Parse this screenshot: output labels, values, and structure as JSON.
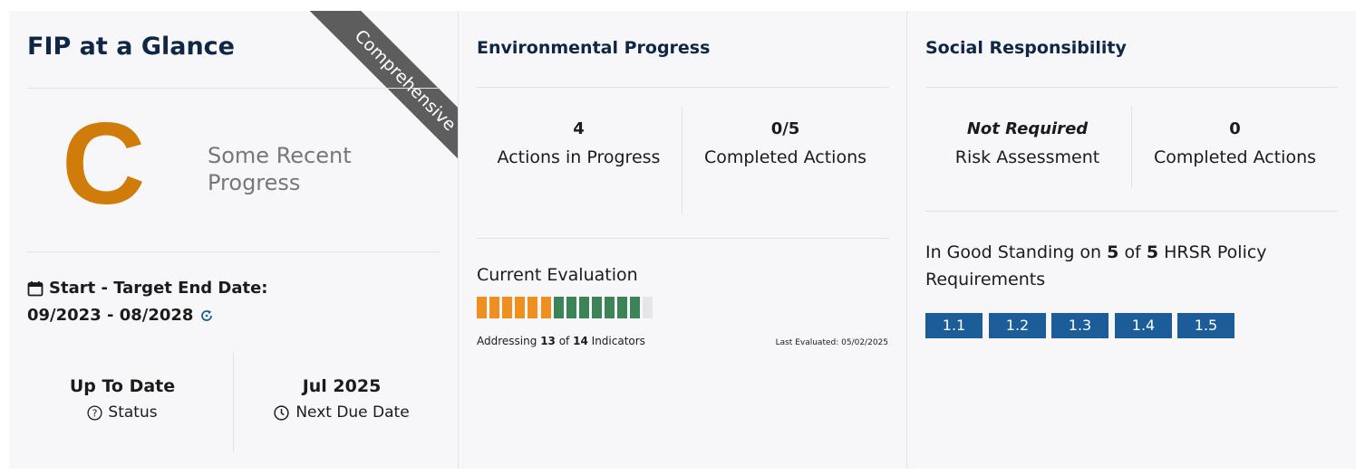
{
  "glance": {
    "title": "FIP at a Glance",
    "ribbon": "Comprehensive",
    "grade": "C",
    "grade_label": "Some Recent Progress",
    "date_label": "Start - Target End Date:",
    "date_value": "09/2023 - 08/2028",
    "status_value": "Up To Date",
    "status_label": "Status",
    "due_value": "Jul 2025",
    "due_label": "Next Due Date"
  },
  "environmental": {
    "title": "Environmental Progress",
    "actions_in_progress_value": "4",
    "actions_in_progress_label": "Actions in Progress",
    "completed_value": "0/5",
    "completed_label": "Completed Actions",
    "evaluation_title": "Current Evaluation",
    "addressing_prefix": "Addressing",
    "addressing_count": "13",
    "addressing_of": "of",
    "addressing_total": "14",
    "addressing_suffix": "Indicators",
    "last_evaluated": "Last Evaluated: 05/02/2025",
    "segments": [
      "#ee8f1f",
      "#ee8f1f",
      "#ee8f1f",
      "#ee8f1f",
      "#ee8f1f",
      "#ee8f1f",
      "#3c8457",
      "#3c8457",
      "#3c8457",
      "#3c8457",
      "#3c8457",
      "#3c8457",
      "#3c8457",
      "#e6e6e8"
    ]
  },
  "social": {
    "title": "Social Responsibility",
    "risk_value": "Not Required",
    "risk_label": "Risk Assessment",
    "completed_value": "0",
    "completed_label": "Completed Actions",
    "standing_prefix": "In Good Standing on",
    "standing_count": "5",
    "standing_of": "of",
    "standing_total": "5",
    "standing_suffix": "HRSR Policy Requirements",
    "policies": [
      "1.1",
      "1.2",
      "1.3",
      "1.4",
      "1.5"
    ]
  },
  "colors": {
    "grade": "#d07c0a",
    "tag": "#1c5d99",
    "heading": "#0f2744",
    "ribbon": "#5d5d5d"
  }
}
